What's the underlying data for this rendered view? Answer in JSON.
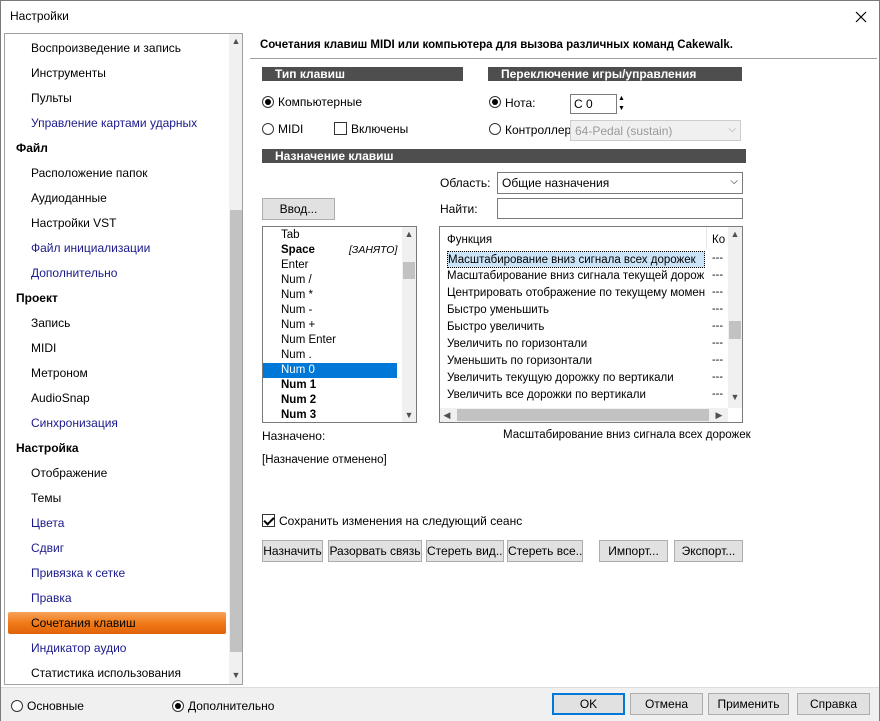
{
  "window": {
    "title": "Настройки"
  },
  "nav": {
    "items": [
      {
        "label": "Воспроизведение и запись",
        "kind": "sub"
      },
      {
        "label": "Инструменты",
        "kind": "sub"
      },
      {
        "label": "Пульты",
        "kind": "sub"
      },
      {
        "label": "Управление картами ударных",
        "kind": "sub",
        "blue": true
      },
      {
        "label": "Файл",
        "kind": "grp"
      },
      {
        "label": "Расположение папок",
        "kind": "sub"
      },
      {
        "label": "Аудиоданные",
        "kind": "sub"
      },
      {
        "label": "Настройки VST",
        "kind": "sub"
      },
      {
        "label": "Файл инициализации",
        "kind": "sub",
        "blue": true
      },
      {
        "label": "Дополнительно",
        "kind": "sub",
        "blue": true
      },
      {
        "label": "Проект",
        "kind": "grp"
      },
      {
        "label": "Запись",
        "kind": "sub"
      },
      {
        "label": "MIDI",
        "kind": "sub"
      },
      {
        "label": "Метроном",
        "kind": "sub"
      },
      {
        "label": "AudioSnap",
        "kind": "sub"
      },
      {
        "label": "Синхронизация",
        "kind": "sub",
        "blue": true
      },
      {
        "label": "Настройка",
        "kind": "grp"
      },
      {
        "label": "Отображение",
        "kind": "sub"
      },
      {
        "label": "Темы",
        "kind": "sub"
      },
      {
        "label": "Цвета",
        "kind": "sub",
        "blue": true
      },
      {
        "label": "Сдвиг",
        "kind": "sub",
        "blue": true
      },
      {
        "label": "Привязка к сетке",
        "kind": "sub",
        "blue": true
      },
      {
        "label": "Правка",
        "kind": "sub",
        "blue": true
      },
      {
        "label": "Сочетания клавиш",
        "kind": "sub",
        "selected": true
      },
      {
        "label": "Индикатор аудио",
        "kind": "sub",
        "blue": true
      },
      {
        "label": "Статистика использования",
        "kind": "sub"
      }
    ]
  },
  "header": {
    "text": "Сочетания клавиш MIDI или компьютера для вызова различных команд Cakewalk."
  },
  "key_type": {
    "title": "Тип клавиш",
    "computer": "Компьютерные",
    "midi": "MIDI",
    "enabled": "Включены"
  },
  "transport": {
    "title": "Переключение игры/управления",
    "note_label": "Нота:",
    "note_value": "C 0",
    "controller_label": "Контроллер:",
    "controller_value": "64-Pedal (sustain)"
  },
  "assign": {
    "title": "Назначение клавиш",
    "area_label": "Область:",
    "area_value": "Общие назначения",
    "find_label": "Найти:",
    "find_value": "",
    "input_button": "Ввод...",
    "keys": [
      {
        "label": "Tab",
        "bold": false
      },
      {
        "label": "Space",
        "bold": true,
        "extra": "[ЗАНЯТО]"
      },
      {
        "label": "Enter",
        "bold": false
      },
      {
        "label": "Num /",
        "bold": false
      },
      {
        "label": "Num *",
        "bold": false
      },
      {
        "label": "Num -",
        "bold": false
      },
      {
        "label": "Num +",
        "bold": false
      },
      {
        "label": "Num Enter",
        "bold": false
      },
      {
        "label": "Num .",
        "bold": false
      },
      {
        "label": "Num 0",
        "bold": false,
        "selected": true
      },
      {
        "label": "Num 1",
        "bold": true
      },
      {
        "label": "Num 2",
        "bold": true
      },
      {
        "label": "Num 3",
        "bold": true
      }
    ],
    "func_header": "Функция",
    "key_header": "Ко",
    "functions": [
      {
        "label": "Масштабирование вниз сигнала всех дорожек",
        "key": "---",
        "selected": true
      },
      {
        "label": "Масштабирование вниз сигнала текущей дорож...",
        "key": "---"
      },
      {
        "label": "Центрировать отображение по текущему момен...",
        "key": "---"
      },
      {
        "label": "Быстро уменьшить",
        "key": "---"
      },
      {
        "label": "Быстро увеличить",
        "key": "---"
      },
      {
        "label": "Увеличить по горизонтали",
        "key": "---"
      },
      {
        "label": "Уменьшить по горизонтали",
        "key": "---"
      },
      {
        "label": "Увеличить текущую дорожку по вертикали",
        "key": "---"
      },
      {
        "label": "Увеличить все дорожки по вертикали",
        "key": "---"
      }
    ],
    "assigned_label": "Назначено:",
    "assigned_value": "Масштабирование вниз сигнала всех дорожек",
    "status": "[Назначение отменено]",
    "save_label": "Сохранить изменения на следующий сеанс",
    "buttons": {
      "assign": "Назначить",
      "unbind": "Разорвать связь",
      "clear_view": "Стереть вид...",
      "clear_all": "Стереть все...",
      "import": "Импорт...",
      "export": "Экспорт..."
    }
  },
  "footer": {
    "basic": "Основные",
    "advanced": "Дополнительно",
    "ok": "OK",
    "cancel": "Отмена",
    "apply": "Применить",
    "help": "Справка"
  }
}
